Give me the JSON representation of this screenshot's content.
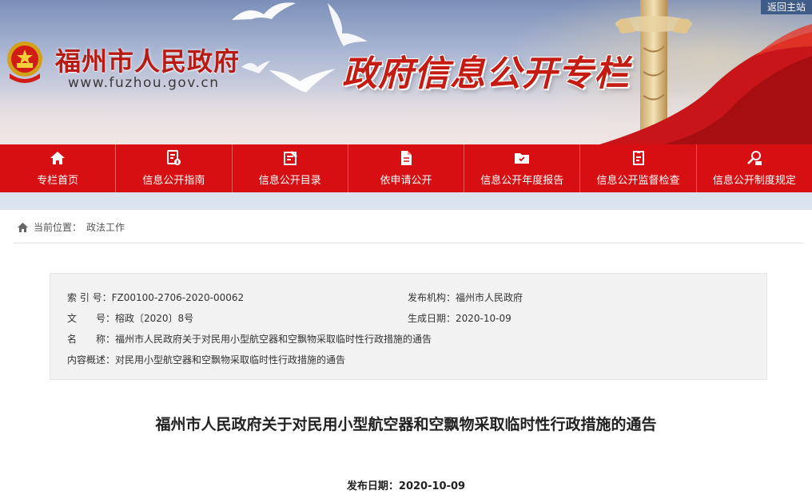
{
  "header": {
    "site_title": "福州市人民政府",
    "site_url": "www.fuzhou.gov.cn",
    "column_title": "政府信息公开专栏",
    "back_link": "返回主站"
  },
  "nav": {
    "items": [
      {
        "label": "专栏首页",
        "icon": "home-icon"
      },
      {
        "label": "信息公开指南",
        "icon": "guide-icon"
      },
      {
        "label": "信息公开目录",
        "icon": "catalog-icon"
      },
      {
        "label": "依申请公开",
        "icon": "document-icon"
      },
      {
        "label": "信息公开年度报告",
        "icon": "folder-icon"
      },
      {
        "label": "信息公开监督检查",
        "icon": "inspection-icon"
      },
      {
        "label": "信息公开制度规定",
        "icon": "regulation-search-icon"
      }
    ]
  },
  "breadcrumb": {
    "prefix": "当前位置：",
    "current": "政法工作"
  },
  "meta": {
    "index_label": "索 引 号：",
    "index_value": "FZ00100-2706-2020-00062",
    "publisher_label": "发布机构：",
    "publisher_value": "福州市人民政府",
    "doc_no_label": "文　　号：",
    "doc_no_value": "榕政〔2020〕8号",
    "created_label": "生成日期：",
    "created_value": "2020-10-09",
    "name_label": "名　　称：",
    "name_value": "福州市人民政府关于对民用小型航空器和空飘物采取临时性行政措施的通告",
    "summary_label": "内容概述：",
    "summary_value": "对民用小型航空器和空飘物采取临时性行政措施的通告"
  },
  "article": {
    "title": "福州市人民政府关于对民用小型航空器和空飘物采取临时性行政措施的通告",
    "date_label": "发布日期：",
    "date_value": "2020-10-09"
  },
  "colors": {
    "brand_red": "#d70f12",
    "title_red": "#c41b12",
    "back_button": "#3f5b87"
  }
}
